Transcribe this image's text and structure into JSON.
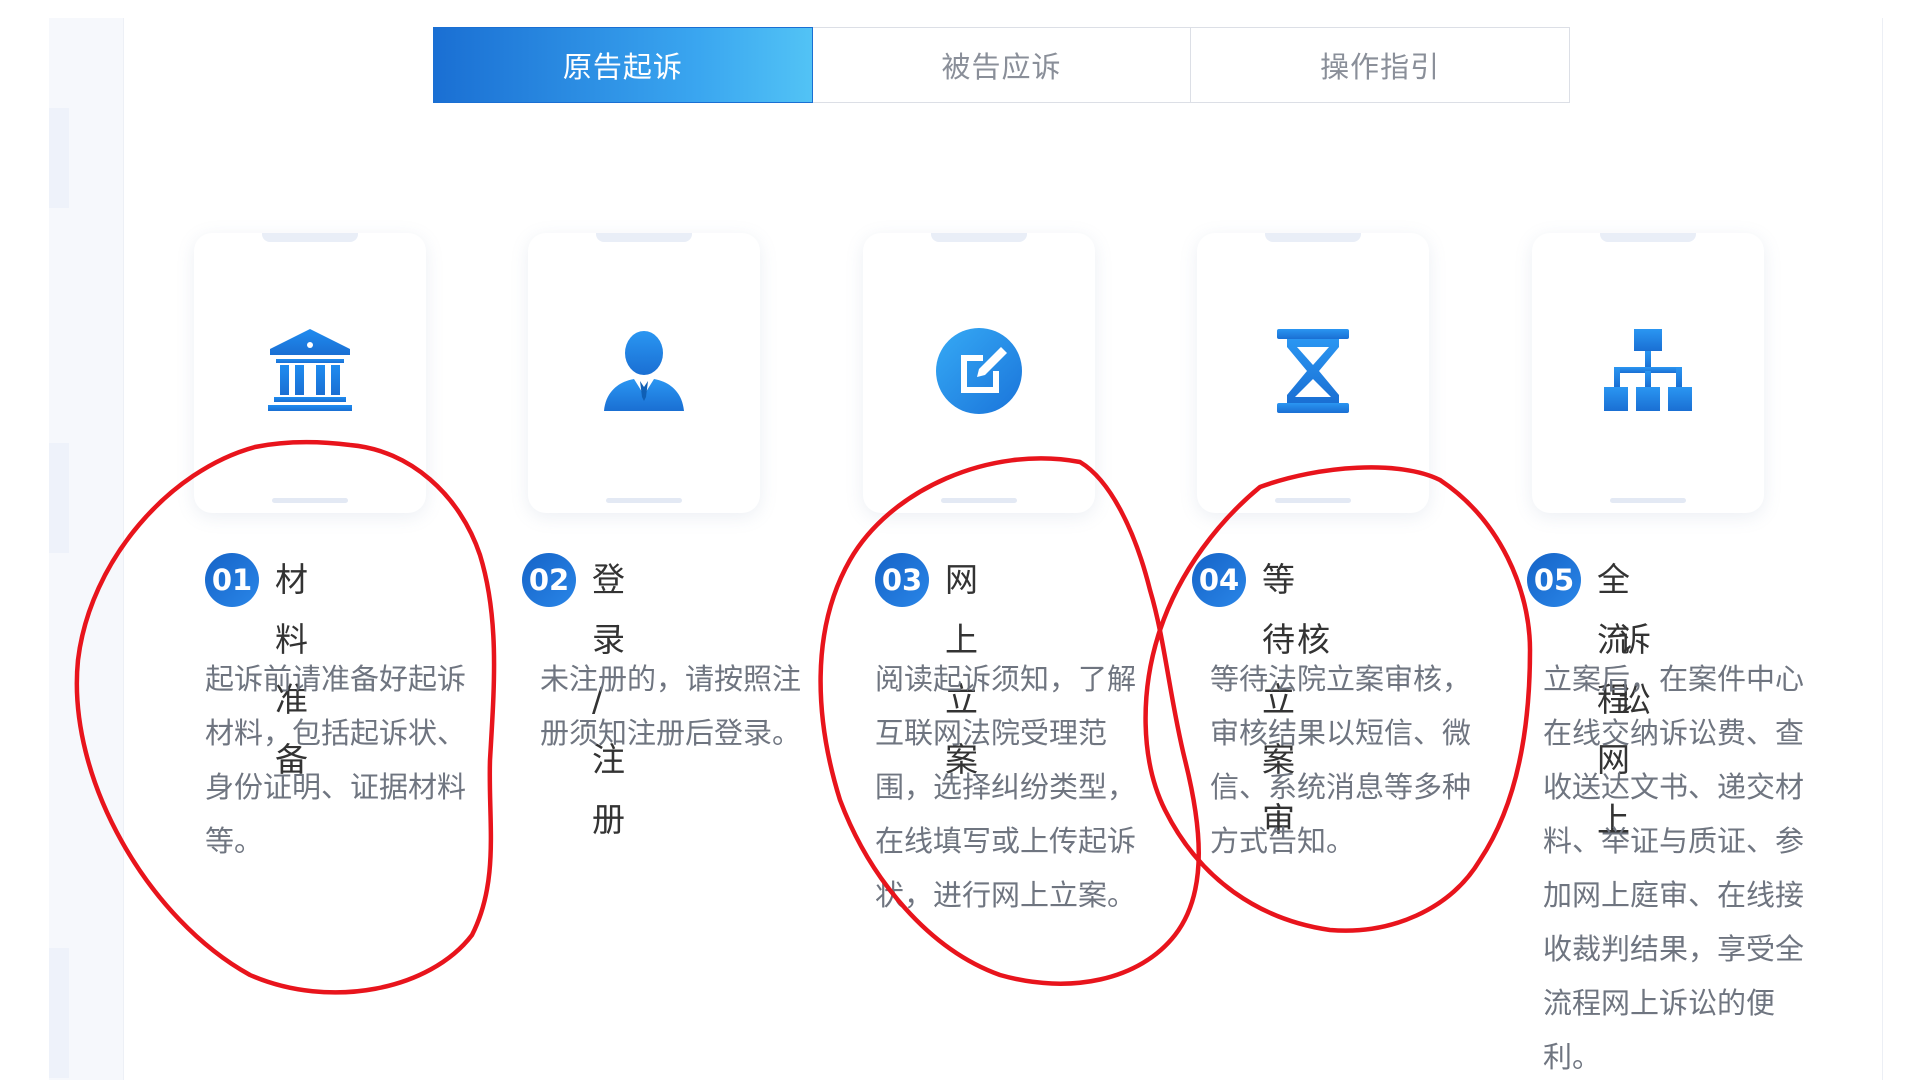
{
  "tabs": [
    {
      "label": "原告起诉",
      "active": true
    },
    {
      "label": "被告应诉",
      "active": false
    },
    {
      "label": "操作指引",
      "active": false
    }
  ],
  "steps": [
    {
      "number": "01",
      "icon": "courthouse-icon",
      "title": "材料准备",
      "title_line2": "",
      "description": "起诉前请准备好起诉材料，包括起诉状、身份证明、证据材料等。"
    },
    {
      "number": "02",
      "icon": "user-icon",
      "title": "登录 / 注册",
      "title_line2": "",
      "description": "未注册的，请按照注册须知注册后登录。"
    },
    {
      "number": "03",
      "icon": "edit-icon",
      "title": "网上立案",
      "title_line2": "",
      "description": "阅读起诉须知，了解互联网法院受理范围，选择纠纷类型，在线填写或上传起诉状，进行网上立案。"
    },
    {
      "number": "04",
      "icon": "hourglass-icon",
      "title": "等待立案审",
      "title_line2": "核",
      "description": "等待法院立案审核，审核结果以短信、微信、系统消息等多种方式告知。"
    },
    {
      "number": "05",
      "icon": "hierarchy-icon",
      "title": "全流程网上",
      "title_line2": "诉讼",
      "description": "立案后，在案件中心在线交纳诉讼费、查收送达文书、递交材料、举证与质证、参加网上庭审、在线接收裁判结果，享受全流程网上诉讼的便利。"
    }
  ],
  "colors": {
    "accent_blue": "#1a6fd3",
    "icon_blue": "#1e88e8",
    "annotation_red": "#e8141c"
  }
}
